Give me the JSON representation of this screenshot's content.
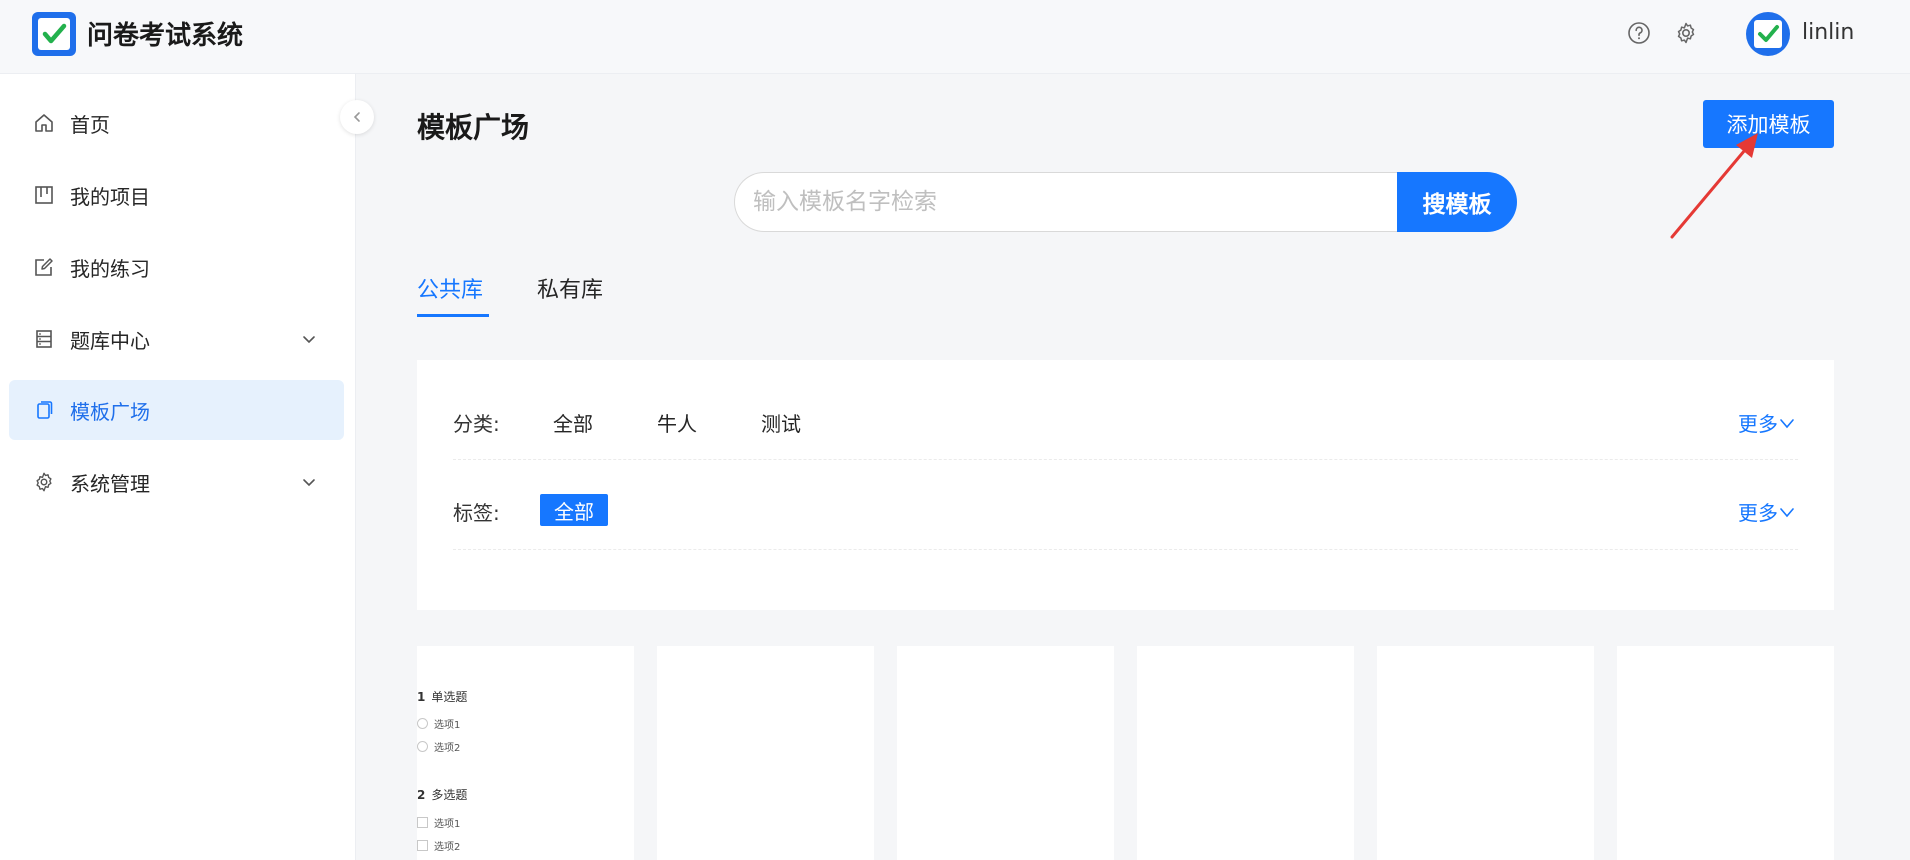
{
  "app": {
    "title": "问卷考试系统",
    "username": "linlin"
  },
  "header_icons": [
    "help-icon",
    "settings-icon"
  ],
  "sidebar": {
    "items": [
      {
        "label": "首页",
        "icon": "home-icon"
      },
      {
        "label": "我的项目",
        "icon": "project-icon"
      },
      {
        "label": "我的练习",
        "icon": "edit-icon"
      },
      {
        "label": "题库中心",
        "icon": "database-icon",
        "expandable": true
      },
      {
        "label": "模板广场",
        "icon": "template-icon",
        "active": true
      },
      {
        "label": "系统管理",
        "icon": "gear-icon",
        "expandable": true
      }
    ]
  },
  "main": {
    "title": "模板广场",
    "add_button": "添加模板",
    "search": {
      "placeholder": "输入模板名字检索",
      "value": "",
      "button": "搜模板"
    },
    "tabs": [
      {
        "label": "公共库",
        "active": true
      },
      {
        "label": "私有库",
        "active": false
      }
    ],
    "filters": {
      "category_label": "分类:",
      "categories": [
        "全部",
        "牛人",
        "测试"
      ],
      "tag_label": "标签:",
      "tags": [
        "全部"
      ],
      "more": "更多"
    },
    "cards": [
      {
        "questions": [
          {
            "num": "1",
            "title": "单选题",
            "type": "radio",
            "options": [
              "选项1",
              "选项2"
            ]
          },
          {
            "num": "2",
            "title": "多选题",
            "type": "checkbox",
            "options": [
              "选项1",
              "选项2"
            ]
          }
        ]
      },
      {
        "questions": []
      },
      {
        "questions": []
      },
      {
        "questions": []
      },
      {
        "questions": []
      },
      {
        "questions": []
      }
    ]
  },
  "colors": {
    "primary": "#1677ff",
    "active_bg": "#e6f1fd",
    "annotation_arrow": "#e53935"
  }
}
